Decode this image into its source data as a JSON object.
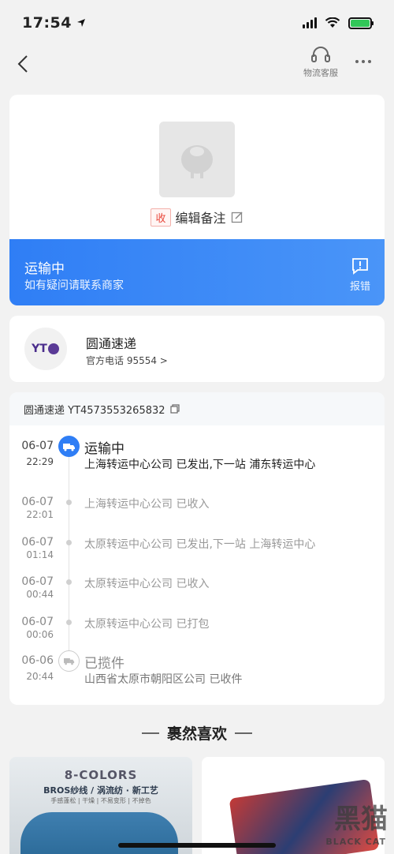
{
  "status_bar": {
    "time": "17:54"
  },
  "nav": {
    "service_label": "物流客服"
  },
  "package": {
    "tag": "收",
    "note": "编辑备注",
    "status_title": "运输中",
    "status_sub": "如有疑问请联系商家",
    "report_label": "报错"
  },
  "courier": {
    "logo_text": "YT",
    "name": "圆通速递",
    "phone": "官方电话 95554 >"
  },
  "tracking": {
    "header": "圆通速递 YT4573553265832",
    "events": [
      {
        "date": "06-07",
        "time": "22:29",
        "title": "运输中",
        "text": "上海转运中心公司 已发出,下一站 浦东转运中心"
      },
      {
        "date": "06-07",
        "time": "22:01",
        "text": "上海转运中心公司 已收入"
      },
      {
        "date": "06-07",
        "time": "01:14",
        "text": "太原转运中心公司 已发出,下一站 上海转运中心"
      },
      {
        "date": "06-07",
        "time": "00:44",
        "text": "太原转运中心公司 已收入"
      },
      {
        "date": "06-07",
        "time": "00:06",
        "text": "太原转运中心公司 已打包"
      },
      {
        "date": "06-06",
        "time": "20:44",
        "title": "已揽件",
        "text": "山西省太原市朝阳区公司 已收件"
      }
    ]
  },
  "recommend": {
    "title": "裹然喜欢",
    "left_title": "8-COLORS",
    "left_sub": "BROS纱线 / 涡流纺 · 新工艺",
    "left_tiny": "手感蓬松 | 干燥 | 不易变形 | 不掉色"
  },
  "watermark": {
    "text": "黑猫",
    "sub": "BLACK CAT"
  },
  "colors": {
    "accent": "#2f7ef5",
    "banner_end": "#4a95f8",
    "tag_red": "#e8463a"
  }
}
